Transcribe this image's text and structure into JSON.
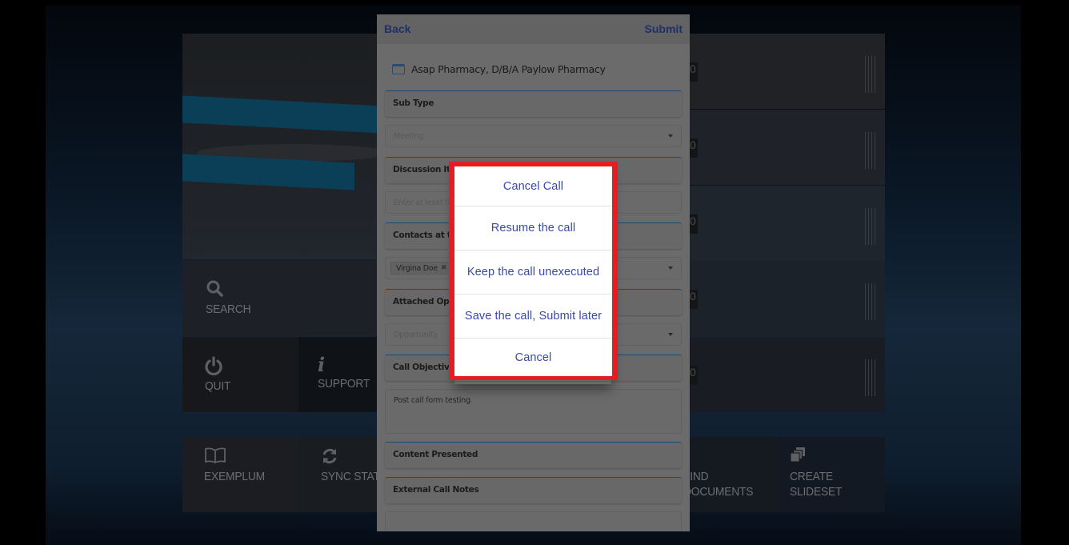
{
  "background_app": {
    "tiles": {
      "search": {
        "label": "SEARCH",
        "icon": "search-icon"
      },
      "quit": {
        "label": "QUIT",
        "icon": "power-icon"
      },
      "support": {
        "label": "SUPPORT",
        "icon": "info-icon"
      },
      "exemplum": {
        "label": "EXEMPLUM",
        "icon": "book-icon"
      },
      "sync_status": {
        "label": "SYNC STATUS",
        "icon": "sync-icon"
      },
      "find_documents": {
        "label_line1": "FIND",
        "label_line2": "DOCUMENTS",
        "icon": "document-icon"
      },
      "create_slideset": {
        "label_line1": "CREATE",
        "label_line2": "SLIDESET",
        "icon": "stacked-slides-icon"
      }
    },
    "right_rows_tab_text": "0"
  },
  "call_form": {
    "header": {
      "back_label": "Back",
      "submit_label": "Submit"
    },
    "account": {
      "icon": "account-icon",
      "name": "Asap Pharmacy, D/B/A Paylow Pharmacy"
    },
    "sections": {
      "sub_type": {
        "title": "Sub Type",
        "value_placeholder": "Meeting"
      },
      "discussion_items": {
        "title": "Discussion Items",
        "placeholder": "Enter at least three characters"
      },
      "contacts": {
        "title": "Contacts at the Call",
        "chips": [
          "Virgina Doe"
        ]
      },
      "attached_opportunity": {
        "title": "Attached Opportunity",
        "placeholder": "Opportunity"
      },
      "call_objectives": {
        "title": "Call Objectives",
        "value": "Post call form testing"
      },
      "content_presented": {
        "title": "Content Presented"
      },
      "external_call_notes": {
        "title": "External Call Notes"
      }
    }
  },
  "action_sheet": {
    "highlight_color": "#e41c24",
    "text_color": "#3949ab",
    "items": [
      {
        "label": "Cancel Call"
      },
      {
        "label": "Resume the call"
      },
      {
        "label": "Keep the call unexecuted"
      },
      {
        "label": "Save the call, Submit later"
      },
      {
        "label": "Cancel"
      }
    ]
  }
}
